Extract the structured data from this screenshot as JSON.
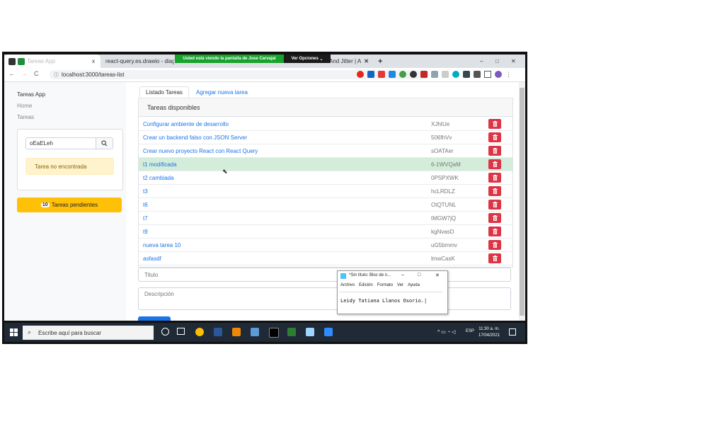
{
  "browser": {
    "tabs": [
      {
        "label": "Tareas App",
        "close": "x"
      },
      {
        "label": "react-query.es.drawio - diagrams.net"
      },
      {
        "label": "f And Jitter | A"
      }
    ],
    "share_notice": "Usted está viendo la pantalla de Jose Carvajal",
    "share_options": "Ver Opciones",
    "url": "localhost:3000/tareas-list",
    "new_tab": "+",
    "window_controls": [
      "–",
      "□",
      "✕"
    ]
  },
  "sidebar": {
    "brand": "Tareas App",
    "nav": [
      {
        "label": "Home"
      },
      {
        "label": "Tareas"
      }
    ],
    "search": {
      "value": "oEaELeh"
    },
    "alert": "Tarea no encontrada",
    "pending": {
      "count": "10",
      "label": "Tareas pendientes"
    }
  },
  "main": {
    "tabs": [
      {
        "label": "Listado Tareas"
      },
      {
        "label": "Agregar nueva tarea"
      }
    ],
    "list_header": "Tareas disponibles",
    "tasks": [
      {
        "title": "Configurar ambiente de desarrollo",
        "id": "XJhtUe"
      },
      {
        "title": "Crear un backend falso con JSON Server",
        "id": "506fhVv"
      },
      {
        "title": "Crear nuevo proyecto React con React Query",
        "id": "sOATAer"
      },
      {
        "title": "t1 modificada",
        "id": "6-1WVQaM"
      },
      {
        "title": "t2 cambiada",
        "id": "0PSPXWK"
      },
      {
        "title": "t3",
        "id": "hcLRDLZ"
      },
      {
        "title": "t6",
        "id": "OtQTUNL"
      },
      {
        "title": "t7",
        "id": "tMGW7jQ"
      },
      {
        "title": "t9",
        "id": "kgNvasD"
      },
      {
        "title": "nueva tarea 10",
        "id": "uG5bmmv"
      },
      {
        "title": "asfasdf",
        "id": "lmwCasK"
      }
    ],
    "selected_index": 3,
    "title_placeholder": "Titulo",
    "description_placeholder": "Descripción"
  },
  "notepad": {
    "title": "*Sin título: Bloc de n...",
    "menu": [
      "Archivo",
      "Edición",
      "Formato",
      "Ver",
      "Ayuda"
    ],
    "content": "Leidy Tatiana Llanos Osorio."
  },
  "taskbar": {
    "search_placeholder": "Escribe aquí para buscar",
    "lang": "ESP",
    "time": "11:30 a. m.",
    "date": "17/04/2021"
  },
  "colors": {
    "danger": "#dc3545",
    "warning": "#ffc107",
    "link": "#1a73e8",
    "selected": "#d4edda"
  }
}
